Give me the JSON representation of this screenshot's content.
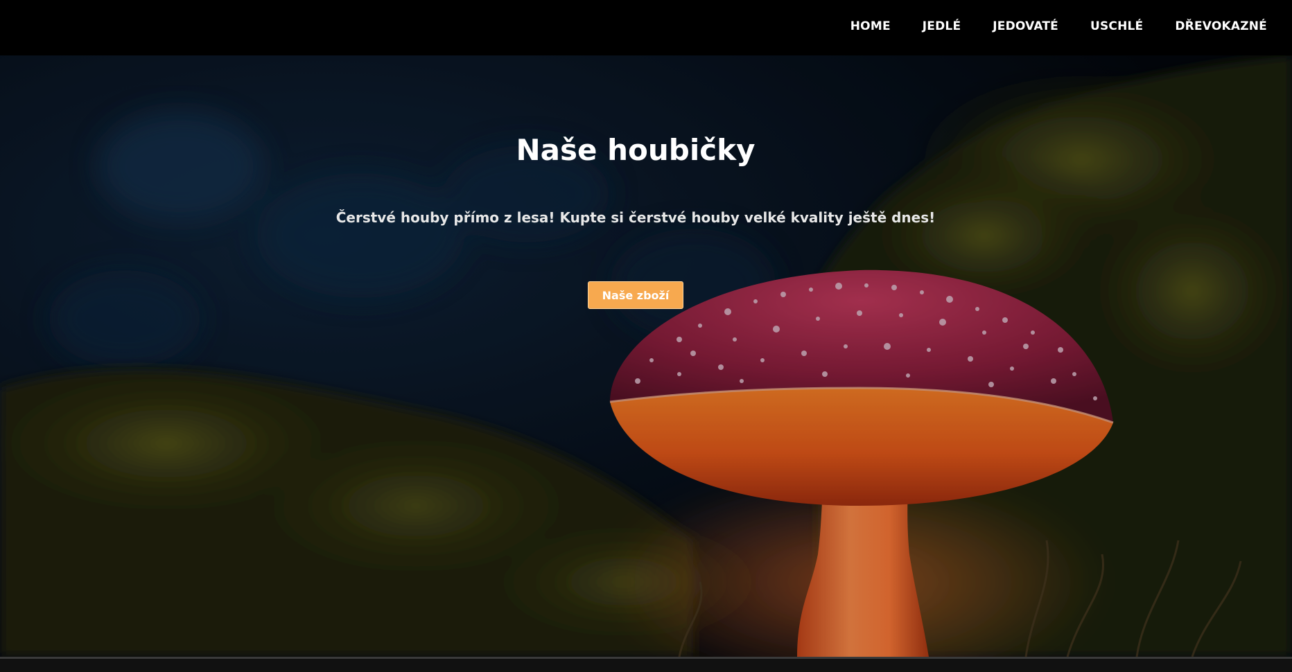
{
  "nav": {
    "items": [
      {
        "label": "HOME"
      },
      {
        "label": "JEDLÉ"
      },
      {
        "label": "JEDOVATÉ"
      },
      {
        "label": "USCHLÉ"
      },
      {
        "label": "DŘEVOKAZNÉ"
      }
    ]
  },
  "hero": {
    "title": "Naše houbičky",
    "subtitle": "Čerstvé houby přímo z lesa! Kupte si čerstvé houby velké kvality ještě dnes!",
    "cta_label": "Naše zboží",
    "background_image": "glowing-red-mushroom-in-dark-forest"
  },
  "colors": {
    "nav_bg": "#000000",
    "cta_bg": "#f7a94f",
    "text": "#ffffff"
  }
}
